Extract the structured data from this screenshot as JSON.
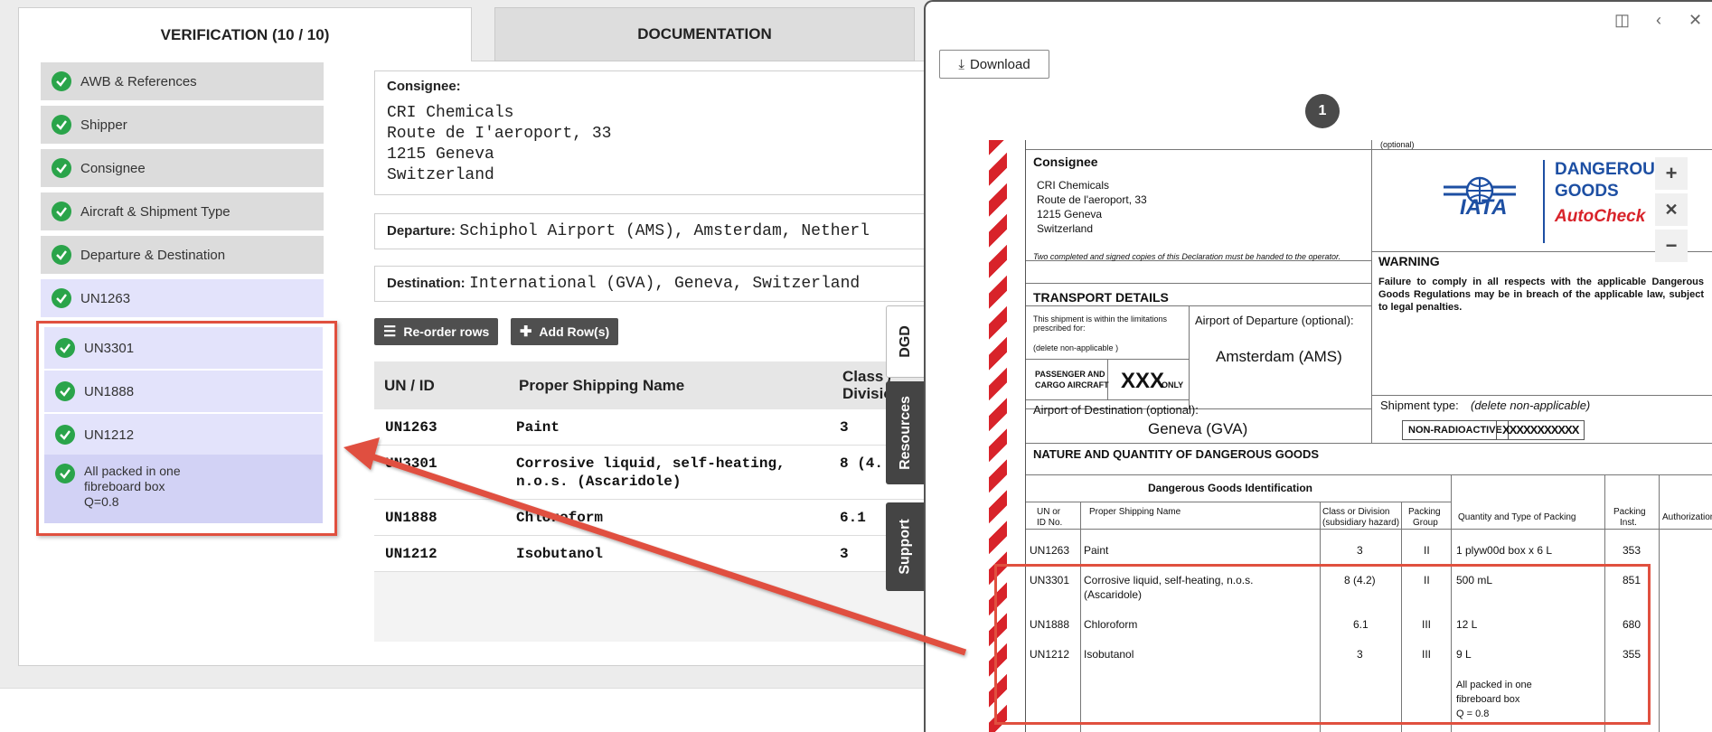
{
  "tabs": {
    "verification": "VERIFICATION (10 / 10)",
    "documentation": "DOCUMENTATION"
  },
  "sidebar": {
    "items": [
      {
        "label": "AWB & References"
      },
      {
        "label": "Shipper"
      },
      {
        "label": "Consignee"
      },
      {
        "label": "Aircraft & Shipment Type"
      },
      {
        "label": "Departure & Destination"
      },
      {
        "label": "UN1263"
      }
    ],
    "group": [
      {
        "label": "UN3301"
      },
      {
        "label": "UN1888"
      },
      {
        "label": "UN1212"
      }
    ],
    "group_note": [
      "All packed in one",
      "fibreboard box",
      "Q=0.8"
    ]
  },
  "consignee": {
    "label": "Consignee:",
    "lines": [
      "CRI Chemicals",
      "Route de I'aeroport, 33",
      "1215 Geneva",
      "Switzerland"
    ]
  },
  "departure": {
    "label": "Departure:",
    "value": "Schiphol Airport (AMS), Amsterdam, Netherl"
  },
  "destination": {
    "label": "Destination:",
    "value": "International (GVA), Geneva, Switzerland"
  },
  "buttons": {
    "reorder": "Re-order rows",
    "add_rows": "Add Row(s)"
  },
  "table": {
    "headers": {
      "un": "UN / ID",
      "psn": "Proper Shipping Name",
      "class1": "Class /",
      "class2": "Divisio"
    },
    "rows": [
      {
        "un": "UN1263",
        "psn1": "Paint",
        "psn2": "",
        "cls": "3"
      },
      {
        "un": "UN3301",
        "psn1": "Corrosive liquid, self-heating,",
        "psn2": "n.o.s. (Ascaridole)",
        "cls": "8 (4."
      },
      {
        "un": "UN1888",
        "psn1": "Chloroform",
        "psn2": "",
        "cls": "6.1"
      },
      {
        "un": "UN1212",
        "psn1": "Isobutanol",
        "psn2": "",
        "cls": "3"
      }
    ]
  },
  "side_tabs": {
    "dgd": "DGD",
    "resources": "Resources",
    "support": "Support"
  },
  "viewer": {
    "download": "Download",
    "page": "1",
    "doc": {
      "optional_top": "(optional)",
      "consignee_label": "Consignee",
      "consignee_lines": [
        "CRI Chemicals",
        "Route de l'aeroport, 33",
        "1215 Geneva",
        "Switzerland"
      ],
      "copies_note": "Two completed and signed copies of this Declaration must be handed to the operator.",
      "transport_label": "TRANSPORT DETAILS",
      "limitations_note1": "This shipment is within the limitations",
      "limitations_note2": "prescribed for:",
      "delete_note": "(delete non-applicable )",
      "pax1": "PASSENGER AND",
      "pax2": "CARGO AIRCRAFT",
      "cargo_only": "ONLY",
      "xxx": "XXX",
      "departure_label": "Airport of Departure (optional):",
      "departure_value": "Amsterdam (AMS)",
      "destination_label": "Airport of Destination (optional):",
      "destination_value": "Geneva (GVA)",
      "iata": "IATA",
      "dg_logo1": "DANGEROUS",
      "dg_logo2": "GOODS",
      "autocheck": "AutoCheck",
      "warning_label": "WARNING",
      "warning_text": "Failure to comply in all respects with the applicable Dangerous Goods Regulations may be in breach of the applicable law, subject to legal penalties.",
      "shipment_type_label": "Shipment type:",
      "shipment_type_note": "(delete non-applicable)",
      "non_radioactive": "NON-RADIOACTIVE",
      "radioactive_struck": "XXXXXXXXXXX",
      "nature_label": "NATURE AND QUANTITY OF DANGEROUS GOODS",
      "dgi_label": "Dangerous Goods Identification",
      "cols": {
        "un1": "UN or",
        "un2": "ID No.",
        "psn": "Proper Shipping Name",
        "cls1": "Class or Division",
        "cls2": "(subsidiary hazard)",
        "pg1": "Packing",
        "pg2": "Group",
        "qty": "Quantity and Type of Packing",
        "pi1": "Packing",
        "pi2": "Inst.",
        "auth": "Authorization"
      },
      "rows": [
        {
          "un": "UN1263",
          "psn": "Paint",
          "psn2": "",
          "cls": "3",
          "pg": "II",
          "qty": "1 plyw00d box x 6 L",
          "pi": "353"
        },
        {
          "un": "UN3301",
          "psn": "Corrosive liquid, self-heating, n.o.s.",
          "psn2": "(Ascaridole)",
          "cls": "8 (4.2)",
          "pg": "II",
          "qty": "500 mL",
          "pi": "851"
        },
        {
          "un": "UN1888",
          "psn": "Chloroform",
          "psn2": "",
          "cls": "6.1",
          "pg": "III",
          "qty": "12 L",
          "pi": "680"
        },
        {
          "un": "UN1212",
          "psn": "Isobutanol",
          "psn2": "",
          "cls": "3",
          "pg": "III",
          "qty": "9 L",
          "pi": "355"
        }
      ],
      "pack_note": [
        "All packed in one",
        "fibreboard box",
        "Q = 0.8"
      ]
    }
  }
}
